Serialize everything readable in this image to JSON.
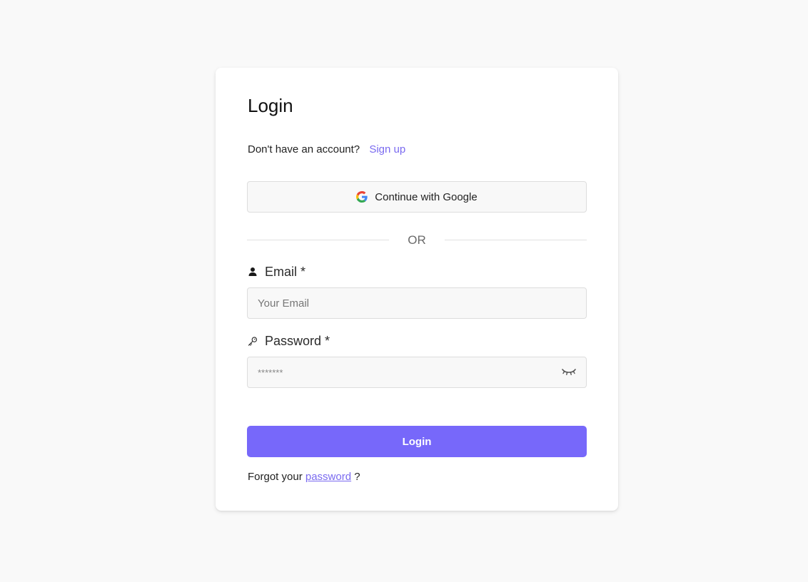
{
  "form": {
    "title": "Login",
    "signup_prompt": "Don't have an account?",
    "signup_link": "Sign up",
    "google_button": "Continue with Google",
    "divider_text": "OR",
    "email_label": "Email *",
    "email_placeholder": "Your Email",
    "password_label": "Password *",
    "password_placeholder": "*******",
    "login_button": "Login",
    "forgot_prefix": "Forgot your",
    "forgot_link": "password",
    "forgot_suffix": "?"
  },
  "icons": {
    "google": "google-icon",
    "email": "user-icon",
    "password": "key-icon",
    "toggle": "eye-closed-icon"
  },
  "colors": {
    "accent": "#7768fa",
    "link": "#7a6af0",
    "background": "#f9f9f9",
    "card": "#ffffff",
    "input_bg": "#f8f8f8"
  }
}
